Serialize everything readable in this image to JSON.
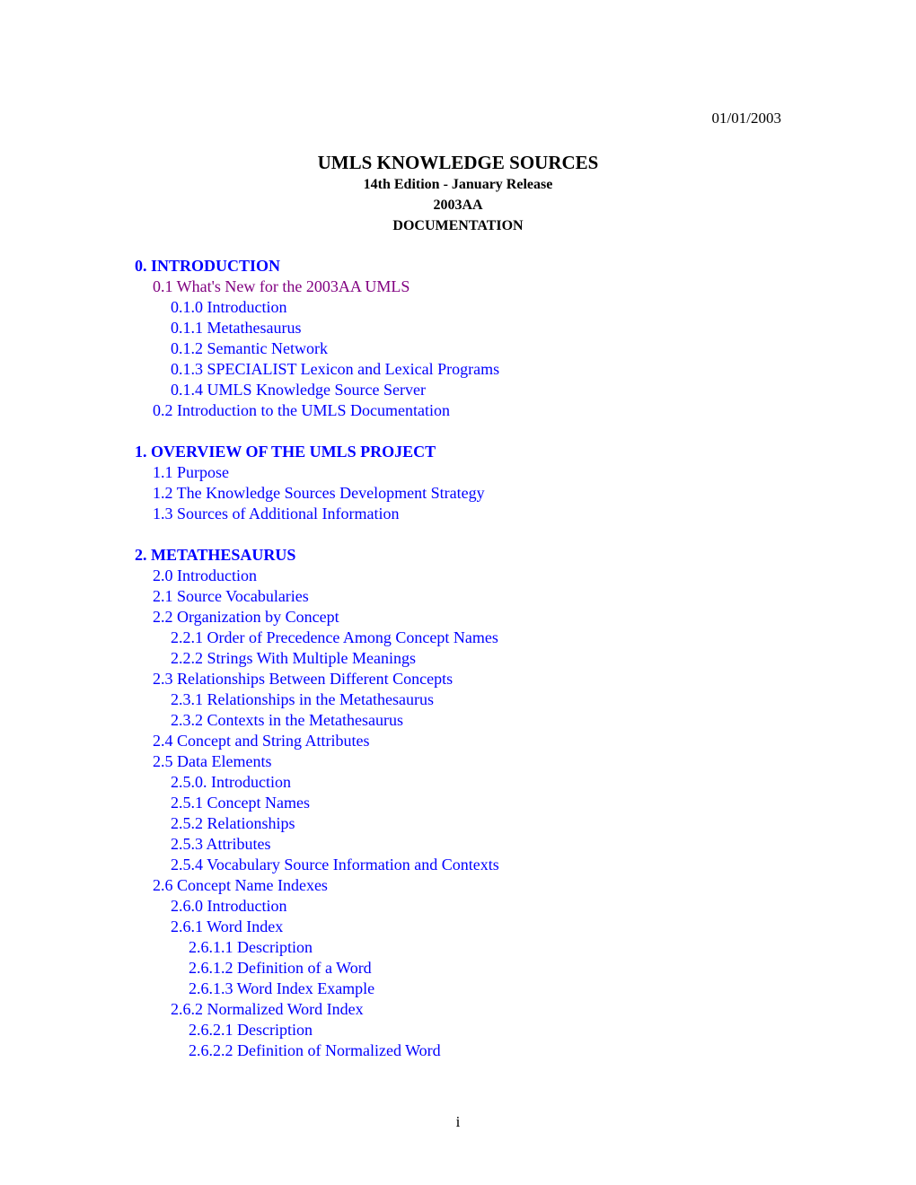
{
  "header": {
    "date": "01/01/2003"
  },
  "title": {
    "main": "UMLS KNOWLEDGE SOURCES",
    "edition": "14th Edition - January Release",
    "release": "2003AA",
    "subtitle": "DOCUMENTATION"
  },
  "colors": {
    "link": "#0000ff",
    "visited_link": "#800080",
    "text": "#000000"
  },
  "toc": {
    "sections": [
      {
        "items": [
          {
            "label": "0. INTRODUCTION",
            "level": 0,
            "visited": false
          },
          {
            "label": "0.1 What's New for the 2003AA UMLS",
            "level": 1,
            "visited": true
          },
          {
            "label": "0.1.0 Introduction",
            "level": 2,
            "visited": false
          },
          {
            "label": "0.1.1 Metathesaurus",
            "level": 2,
            "visited": false
          },
          {
            "label": "0.1.2 Semantic Network",
            "level": 2,
            "visited": false
          },
          {
            "label": "0.1.3 SPECIALIST Lexicon and Lexical Programs",
            "level": 2,
            "visited": false
          },
          {
            "label": "0.1.4 UMLS Knowledge Source Server",
            "level": 2,
            "visited": false
          },
          {
            "label": "0.2 Introduction to the UMLS Documentation",
            "level": 1,
            "visited": false
          }
        ]
      },
      {
        "items": [
          {
            "label": "1. OVERVIEW OF THE UMLS PROJECT",
            "level": 0,
            "visited": false
          },
          {
            "label": "1.1 Purpose",
            "level": 1,
            "visited": false
          },
          {
            "label": "1.2 The Knowledge Sources Development Strategy",
            "level": 1,
            "visited": false
          },
          {
            "label": "1.3 Sources of Additional Information",
            "level": 1,
            "visited": false
          }
        ]
      },
      {
        "items": [
          {
            "label": "2. METATHESAURUS",
            "level": 0,
            "visited": false
          },
          {
            "label": "2.0 Introduction",
            "level": 1,
            "visited": false
          },
          {
            "label": "2.1 Source Vocabularies",
            "level": 1,
            "visited": false
          },
          {
            "label": "2.2 Organization by Concept",
            "level": 1,
            "visited": false
          },
          {
            "label": "2.2.1 Order of Precedence Among Concept Names",
            "level": 2,
            "visited": false
          },
          {
            "label": "2.2.2 Strings With Multiple Meanings",
            "level": 2,
            "visited": false
          },
          {
            "label": "2.3 Relationships Between Different Concepts",
            "level": 1,
            "visited": false
          },
          {
            "label": "2.3.1 Relationships in the Metathesaurus",
            "level": 2,
            "visited": false
          },
          {
            "label": "2.3.2 Contexts in the Metathesaurus",
            "level": 2,
            "visited": false
          },
          {
            "label": "2.4 Concept and String Attributes",
            "level": 1,
            "visited": false
          },
          {
            "label": "2.5 Data Elements",
            "level": 1,
            "visited": false
          },
          {
            "label": "2.5.0. Introduction",
            "level": 2,
            "visited": false
          },
          {
            "label": "2.5.1 Concept Names",
            "level": 2,
            "visited": false
          },
          {
            "label": "2.5.2 Relationships",
            "level": 2,
            "visited": false
          },
          {
            "label": "2.5.3 Attributes",
            "level": 2,
            "visited": false
          },
          {
            "label": "2.5.4 Vocabulary Source Information and Contexts",
            "level": 2,
            "visited": false
          },
          {
            "label": "2.6 Concept Name Indexes",
            "level": 1,
            "visited": false
          },
          {
            "label": "2.6.0 Introduction",
            "level": 2,
            "visited": false
          },
          {
            "label": "2.6.1 Word Index",
            "level": 2,
            "visited": false
          },
          {
            "label": "2.6.1.1 Description",
            "level": 3,
            "visited": false
          },
          {
            "label": "2.6.1.2 Definition of a Word",
            "level": 3,
            "visited": false
          },
          {
            "label": "2.6.1.3 Word Index Example",
            "level": 3,
            "visited": false
          },
          {
            "label": "2.6.2 Normalized Word Index",
            "level": 2,
            "visited": false
          },
          {
            "label": "2.6.2.1 Description",
            "level": 3,
            "visited": false
          },
          {
            "label": "2.6.2.2 Definition of Normalized Word",
            "level": 3,
            "visited": false
          }
        ]
      }
    ]
  },
  "footer": {
    "page_number": "i"
  }
}
